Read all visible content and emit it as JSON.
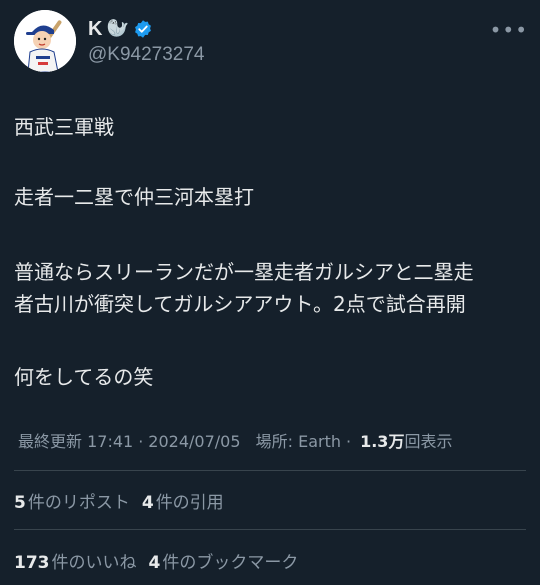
{
  "author": {
    "display_name": "K",
    "name_emoji": "🦭",
    "handle": "@K94273274",
    "avatar_icon": "avatar-illustration"
  },
  "tweet": {
    "lines": [
      "西武三軍戦",
      "走者一二塁で仲三河本塁打",
      "普通ならスリーランだが一塁走者ガルシアと二塁走",
      "者古川が衝突してガルシアアウト。2点で試合再開",
      "何をしてるの笑"
    ]
  },
  "meta": {
    "updated_label": "最終更新 17:41",
    "date": "2024/07/05",
    "location": "場所: Earth",
    "views_count": "1.3",
    "views_unit": "万",
    "views_label": "回表示"
  },
  "stats": {
    "reposts_count": "5",
    "reposts_label": "件のリポスト",
    "quotes_count": "4",
    "quotes_label": "件の引用",
    "likes_count": "173",
    "likes_label": "件のいいね",
    "bookmarks_count": "4",
    "bookmarks_label": "件のブックマーク"
  },
  "colors": {
    "background": "#15202b",
    "text": "#e7e9ea",
    "secondary": "#8b98a5",
    "verified": "#1d9bf0"
  }
}
